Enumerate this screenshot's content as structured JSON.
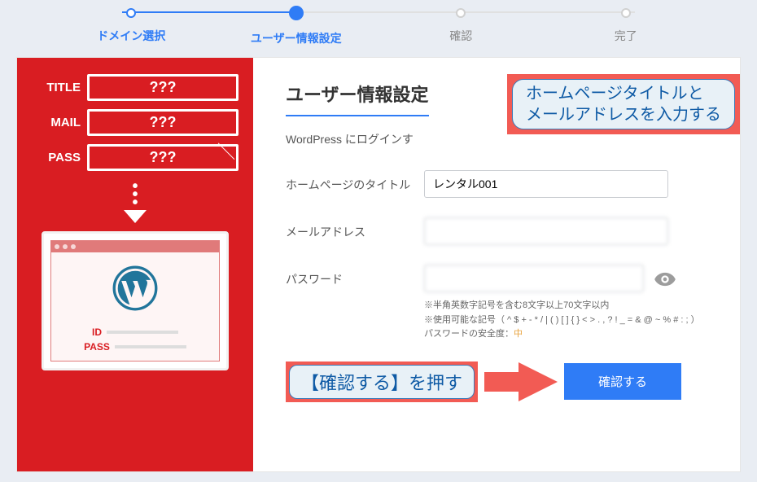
{
  "progress": {
    "step1": "ドメイン選択",
    "step2": "ユーザー情報設定",
    "step3": "確認",
    "step4": "完了"
  },
  "left": {
    "title_label": "TITLE",
    "mail_label": "MAIL",
    "pass_label": "PASS",
    "placeholder": "???",
    "browser_id": "ID",
    "browser_pass": "PASS"
  },
  "main": {
    "heading": "ユーザー情報設定",
    "description_prefix": "WordPress にログインす",
    "labels": {
      "title": "ホームページのタイトル",
      "email": "メールアドレス",
      "password": "パスワード"
    },
    "values": {
      "title": "レンタル001",
      "email": "",
      "password": ""
    },
    "hints": {
      "line1": "※半角英数字記号を含む8文字以上70文字以内",
      "line2": "※使用可能な記号（ ^ $ + - * / | ( ) [ ] { } < > . , ? ! _ = & @ ~ % # : ; ）",
      "strength_label": "パスワードの安全度：",
      "strength_value": "中"
    },
    "confirm_button": "確認する"
  },
  "annotations": {
    "top_line1": "ホームページタイトルと",
    "top_line2": "メールアドレスを入力する",
    "bottom": "【確認する】を押す"
  }
}
